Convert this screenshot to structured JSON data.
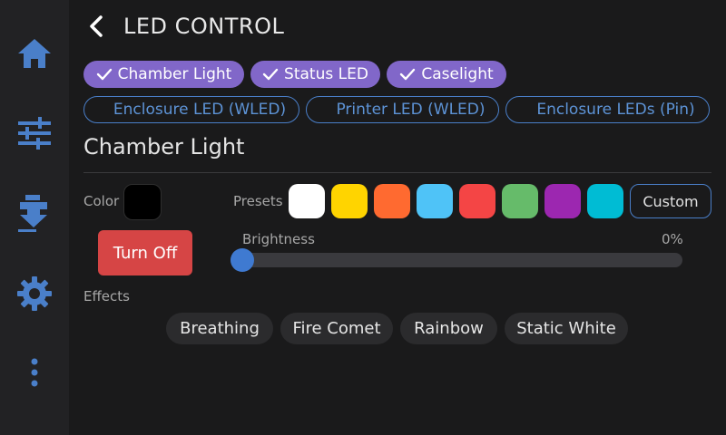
{
  "header": {
    "title": "LED CONTROL"
  },
  "sidebar": {
    "items": [
      {
        "icon": "home-icon"
      },
      {
        "icon": "sliders-icon"
      },
      {
        "icon": "extruder-icon"
      },
      {
        "icon": "gear-icon"
      },
      {
        "icon": "more-vertical-icon"
      }
    ],
    "accent": "#4a7fc9"
  },
  "led_chips": {
    "selected": [
      {
        "label": "Chamber Light"
      },
      {
        "label": "Status LED"
      },
      {
        "label": "Caselight"
      }
    ],
    "unselected": [
      {
        "label": "Enclosure LED (WLED)"
      },
      {
        "label": "Printer LED (WLED)"
      },
      {
        "label": "Enclosure LEDs (Pin)"
      }
    ]
  },
  "section": {
    "title": "Chamber Light",
    "color_label": "Color",
    "current_color": "#000000",
    "presets_label": "Presets",
    "presets": [
      "#ffffff",
      "#ffd400",
      "#ff6a30",
      "#4fc3f7",
      "#f44545",
      "#66bb6a",
      "#9c27b0",
      "#00bcd4"
    ],
    "custom_label": "Custom",
    "turn_off_label": "Turn Off",
    "brightness_label": "Brightness",
    "brightness_value": "0%",
    "brightness_fraction": 0,
    "effects_label": "Effects",
    "effects": [
      {
        "label": "Breathing"
      },
      {
        "label": "Fire Comet"
      },
      {
        "label": "Rainbow"
      },
      {
        "label": "Static White"
      }
    ]
  }
}
